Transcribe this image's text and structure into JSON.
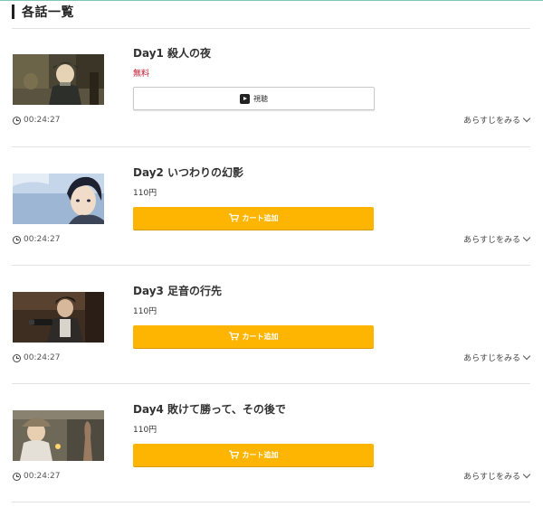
{
  "section": {
    "title": "各話一覧"
  },
  "episodes": [
    {
      "title": "Day1 殺人の夜",
      "price": "無料",
      "duration": "00:24:27",
      "button_label": "視聴",
      "synopsis_label": "あらすじをみる"
    },
    {
      "title": "Day2 いつわりの幻影",
      "price": "110円",
      "duration": "00:24:27",
      "button_label": "カート追加",
      "synopsis_label": "あらすじをみる"
    },
    {
      "title": "Day3 足音の行先",
      "price": "110円",
      "duration": "00:24:27",
      "button_label": "カート追加",
      "synopsis_label": "あらすじをみる"
    },
    {
      "title": "Day4 敗けて勝って、その後で",
      "price": "110円",
      "duration": "00:24:27",
      "button_label": "カート追加",
      "synopsis_label": "あらすじをみる"
    }
  ],
  "colors": {
    "cart_button": "#fdb501",
    "free_price": "#c0142b",
    "accent_rule": "#7fc8b8"
  },
  "icons": {
    "play": "play-icon",
    "cart": "cart-icon",
    "clock": "clock-icon",
    "chevron": "chevron-down-icon"
  }
}
